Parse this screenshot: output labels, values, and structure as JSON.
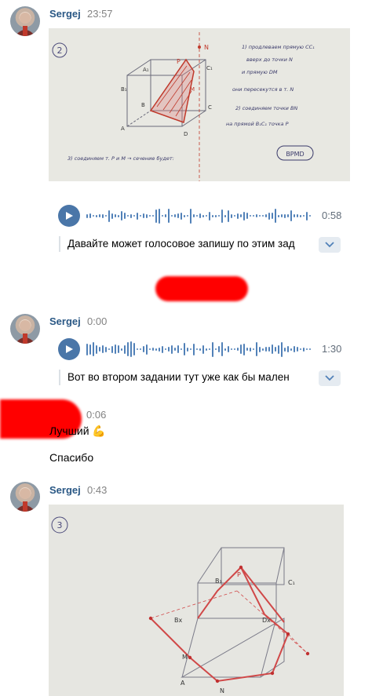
{
  "messages": [
    {
      "sender": "Sergej",
      "time": "23:57",
      "photo": {
        "circle_label": "2",
        "notes_right": [
          "1) продлеваем прямую CC₁",
          "вверх до точки N",
          "и прямую DM",
          "они пересекутся в т. N",
          "2) соединяем точки BN",
          "на прямой B₁C₁ точка P"
        ],
        "bottom_note": "3) соединяем т. P и M   → сечение будет:",
        "answer": "BPMD",
        "labels": {
          "A1": "A₁",
          "B1": "B₁",
          "C1": "C₁",
          "N": "N",
          "P": "P",
          "A": "A",
          "B": "B",
          "C": "C",
          "D": "D",
          "M": "M"
        }
      },
      "voice": {
        "duration": "0:58"
      },
      "transcript": "Давайте может голосовое запишу по этим зад"
    },
    {
      "sender": "Sergej",
      "time": "0:00",
      "voice": {
        "duration": "1:30"
      },
      "transcript": "Вот во втором задании тут уже как бы мален"
    },
    {
      "time": "0:06",
      "texts": [
        "Лучший 💪",
        "Спасибо"
      ]
    },
    {
      "sender": "Sergej",
      "time": "0:43",
      "photo": {
        "circle_label": "3",
        "labels": {
          "B1": "B₁",
          "P": "P",
          "C1": "C₁",
          "Bx": "Bx",
          "Dx": "Dx",
          "M": "M",
          "A": "A",
          "N": "N"
        }
      }
    }
  ],
  "colors": {
    "accent": "#4a76a8",
    "link": "#2a5885",
    "redaction": "#ff0000"
  }
}
